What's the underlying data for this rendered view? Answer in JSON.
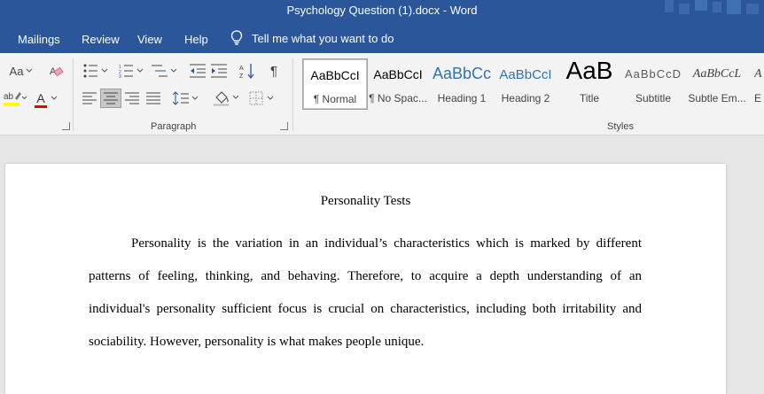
{
  "window": {
    "title": "Psychology Question (1).docx  -  Word"
  },
  "menu": {
    "items": [
      "Mailings",
      "Review",
      "View",
      "Help"
    ],
    "tell_me": "Tell me what you want to do"
  },
  "ribbon": {
    "font_group": {
      "change_case_label": "Aa",
      "font_color_letter": "A"
    },
    "paragraph_group": {
      "label": "Paragraph"
    },
    "styles_group": {
      "label": "Styles",
      "styles": [
        {
          "sample": "AaBbCcI",
          "name": "¶ Normal",
          "selected": true
        },
        {
          "sample": "AaBbCcI",
          "name": "¶ No Spac..."
        },
        {
          "sample": "AaBbCc",
          "name": "Heading 1"
        },
        {
          "sample": "AaBbCcI",
          "name": "Heading 2"
        },
        {
          "sample": "AaB",
          "name": "Title"
        },
        {
          "sample": "AaBbCcD",
          "name": "Subtitle"
        },
        {
          "sample": "AaBbCcL",
          "name": "Subtle Em..."
        },
        {
          "sample": "A",
          "name": "E"
        }
      ]
    },
    "colors": {
      "highlight": "#ffff00",
      "font_color": "#e00000"
    }
  },
  "document": {
    "title": "Personality Tests",
    "paragraph_lines": [
      "Personality is the variation in an individual’s characteristics which is marked by different",
      "patterns of feeling, thinking, and behaving. Therefore, to acquire a depth understanding of an",
      "individual's personality sufficient focus is crucial on characteristics, including both irritability and",
      "sociability. However, personality is what makes people unique."
    ]
  },
  "theme": {
    "titlebar": "#2b579a"
  }
}
